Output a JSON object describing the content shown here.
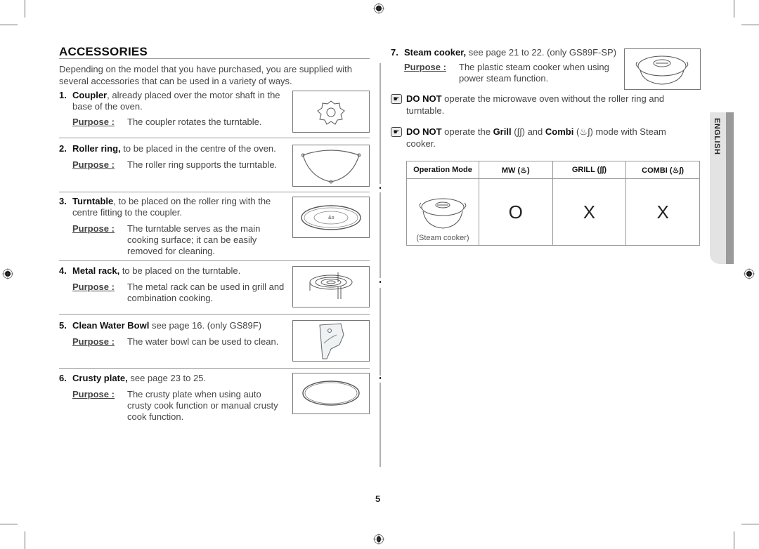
{
  "page": {
    "title": "ACCESSORIES",
    "intro": "Depending on the model that you have purchased, you are supplied with several accessories that can be used in a variety of ways.",
    "purpose_label": "Purpose :",
    "page_number": "5",
    "language_tab": "ENGLISH"
  },
  "items": [
    {
      "num": "1.",
      "name": "Coupler",
      "desc": ", already placed over the motor shaft in the base of the oven.",
      "purpose": "The coupler rotates the turntable.",
      "image": "coupler-image"
    },
    {
      "num": "2.",
      "name": "Roller ring,",
      "desc": " to be placed in the centre of the oven.",
      "purpose": "The roller ring supports the turntable.",
      "image": "roller-ring-image"
    },
    {
      "num": "3.",
      "name": "Turntable",
      "desc": ", to be placed on the roller ring with the centre fitting to the coupler.",
      "purpose": "The turntable serves as the main cooking surface; it can be easily removed for cleaning.",
      "image": "turntable-image"
    },
    {
      "num": "4.",
      "name": "Metal rack,",
      "desc": " to be placed on the turntable.",
      "purpose": "The metal rack can be used in grill and combination cooking.",
      "image": "metal-rack-image"
    },
    {
      "num": "5.",
      "name": "Clean Water Bowl",
      "desc": " see page 16. (only GS89F)",
      "purpose": "The water bowl can be used to clean.",
      "image": "water-bowl-image"
    },
    {
      "num": "6.",
      "name": "Crusty plate,",
      "desc": " see page 23 to 25.",
      "purpose": "The crusty plate when using auto crusty cook function or manual crusty cook function.",
      "image": "crusty-plate-image"
    },
    {
      "num": "7.",
      "name": "Steam cooker,",
      "desc": " see page 21 to 22. (only GS89F-SP)",
      "purpose": "The plastic steam cooker when using power steam function.",
      "image": "steam-cooker-image"
    }
  ],
  "notes": [
    {
      "icon": "pointing-hand-icon",
      "bold": "DO NOT",
      "text": " operate the microwave oven without the roller ring and turntable."
    },
    {
      "icon": "pointing-hand-icon",
      "bold1": "DO NOT",
      "text1": " operate the ",
      "bold2": "Grill",
      "text2": " (∫∫) and ",
      "bold3": "Combi",
      "text3": " (♨∫) mode with Steam cooker."
    }
  ],
  "table": {
    "headers": [
      "Operation Mode",
      "MW (♨)",
      "GRILL (∫∫)",
      "COMBI (♨∫)"
    ],
    "row": {
      "label": "(Steam cooker)",
      "values": [
        "O",
        "X",
        "X"
      ]
    }
  }
}
